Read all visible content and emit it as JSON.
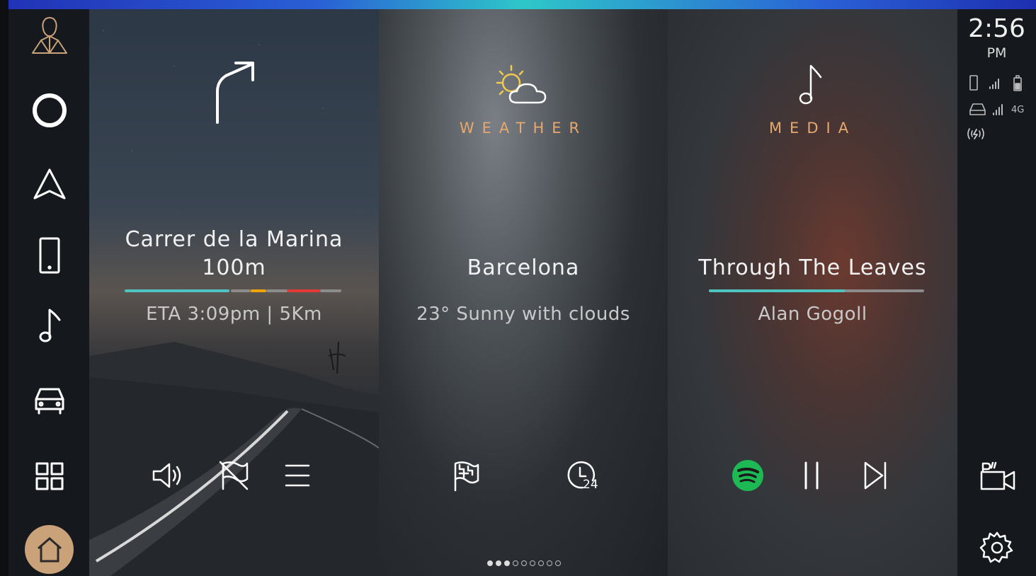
{
  "clock": {
    "time": "2:56",
    "ampm": "PM"
  },
  "status": {
    "network": "4G"
  },
  "navigation": {
    "street": "Carrer de la Marina",
    "distance": "100m",
    "eta": "ETA 3:09pm | 5Km"
  },
  "weather": {
    "label": "WEATHER",
    "city": "Barcelona",
    "conditions": "23° Sunny with clouds",
    "forecast_icon_label": "24"
  },
  "media": {
    "label": "MEDIA",
    "track": "Through The Leaves",
    "artist": "Alan Gogoll",
    "progress": 0.63
  },
  "pager": {
    "total": 9,
    "active": [
      0,
      1,
      2
    ]
  },
  "colors": {
    "accent_teal": "#4ec3c0",
    "traffic_orange": "#f0a400",
    "traffic_red": "#e53935",
    "category_label": "#e7a86e",
    "spotify_green": "#1db954",
    "home_button": "#c9a27a"
  },
  "sidebar_left": [
    "profile-icon",
    "voice-assistant-icon",
    "navigation-icon",
    "phone-icon",
    "music-icon",
    "vehicle-icon",
    "apps-grid-icon",
    "home-icon"
  ],
  "sidebar_right": [
    "parking-camera-icon",
    "settings-icon"
  ]
}
